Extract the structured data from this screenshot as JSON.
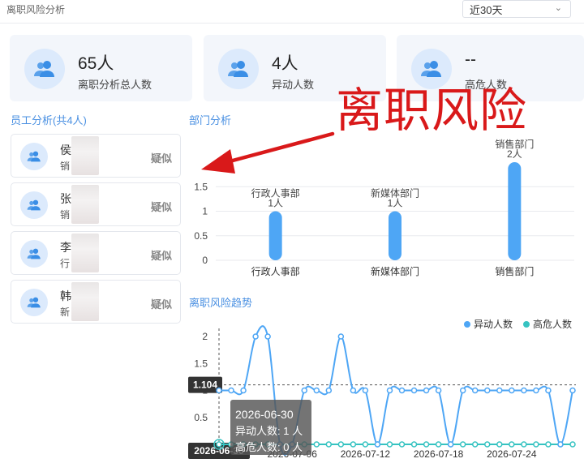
{
  "header": {
    "title": "离职风险分析",
    "range_value": "近30天"
  },
  "stats": [
    {
      "value": "65人",
      "label": "离职分析总人数"
    },
    {
      "value": "4人",
      "label": "异动人数"
    },
    {
      "value": "--",
      "label": "高危人数"
    }
  ],
  "employees_section": {
    "title": "员工分析(共4人)"
  },
  "employees": [
    {
      "name": "侯",
      "dept": "销",
      "tag": "疑似"
    },
    {
      "name": "张",
      "dept": "销",
      "tag": "疑似"
    },
    {
      "name": "李",
      "dept": "行",
      "tag": "疑似"
    },
    {
      "name": "韩",
      "dept": "新",
      "tag": "疑似"
    }
  ],
  "overlay_annotation": "离职风险",
  "colors": {
    "accent": "#4a90e2",
    "bar": "#4ea6f5",
    "alt_series": "#36c3c1",
    "annotation": "#d9191a"
  },
  "chart_data": [
    {
      "type": "bar",
      "title": "部门分析",
      "categories": [
        "行政人事部",
        "新媒体部门",
        "销售部门"
      ],
      "values": [
        1,
        1,
        2
      ],
      "value_labels": [
        "1人",
        "1人",
        "2人"
      ],
      "ylim": [
        0,
        2
      ],
      "yticks": [
        "0",
        "0.5",
        "1",
        "1.5"
      ],
      "grid": true,
      "legend": false
    },
    {
      "type": "line",
      "title": "离职风险趋势",
      "x": [
        "2026-06-30",
        "2026-07-01",
        "2026-07-02",
        "2026-07-03",
        "2026-07-04",
        "2026-07-05",
        "2026-07-06",
        "2026-07-07",
        "2026-07-08",
        "2026-07-09",
        "2026-07-10",
        "2026-07-11",
        "2026-07-12",
        "2026-07-13",
        "2026-07-14",
        "2026-07-15",
        "2026-07-16",
        "2026-07-17",
        "2026-07-18",
        "2026-07-19",
        "2026-07-20",
        "2026-07-21",
        "2026-07-22",
        "2026-07-23",
        "2026-07-24",
        "2026-07-25",
        "2026-07-26",
        "2026-07-27",
        "2026-07-28",
        "2026-07-29"
      ],
      "xticks": [
        "2026-07-06",
        "2026-07-12",
        "2026-07-18",
        "2026-07-24"
      ],
      "series": [
        {
          "name": "异动人数",
          "values": [
            1,
            1,
            1,
            2,
            2,
            0,
            0,
            1,
            1,
            1,
            2,
            1,
            1,
            0,
            1,
            1,
            1,
            1,
            1,
            0,
            1,
            1,
            1,
            1,
            1,
            1,
            1,
            1,
            0,
            1
          ]
        },
        {
          "name": "高危人数",
          "values": [
            0,
            0,
            0,
            0,
            0,
            0,
            0,
            0,
            0,
            0,
            0,
            0,
            0,
            0,
            0,
            0,
            0,
            0,
            0,
            0,
            0,
            0,
            0,
            0,
            0,
            0,
            0,
            0,
            0,
            0
          ]
        }
      ],
      "ylim": [
        0,
        2
      ],
      "yticks": [
        "0.5",
        "1",
        "1.5",
        "2"
      ],
      "legend": "top-right",
      "grid": true,
      "crosshair": {
        "y_value": "1.104",
        "x_value": "2026-06-30"
      },
      "tooltip": {
        "date": "2026-06-30",
        "lines": [
          "异动人数: 1 人",
          "高危人数: 0 人"
        ]
      }
    }
  ]
}
